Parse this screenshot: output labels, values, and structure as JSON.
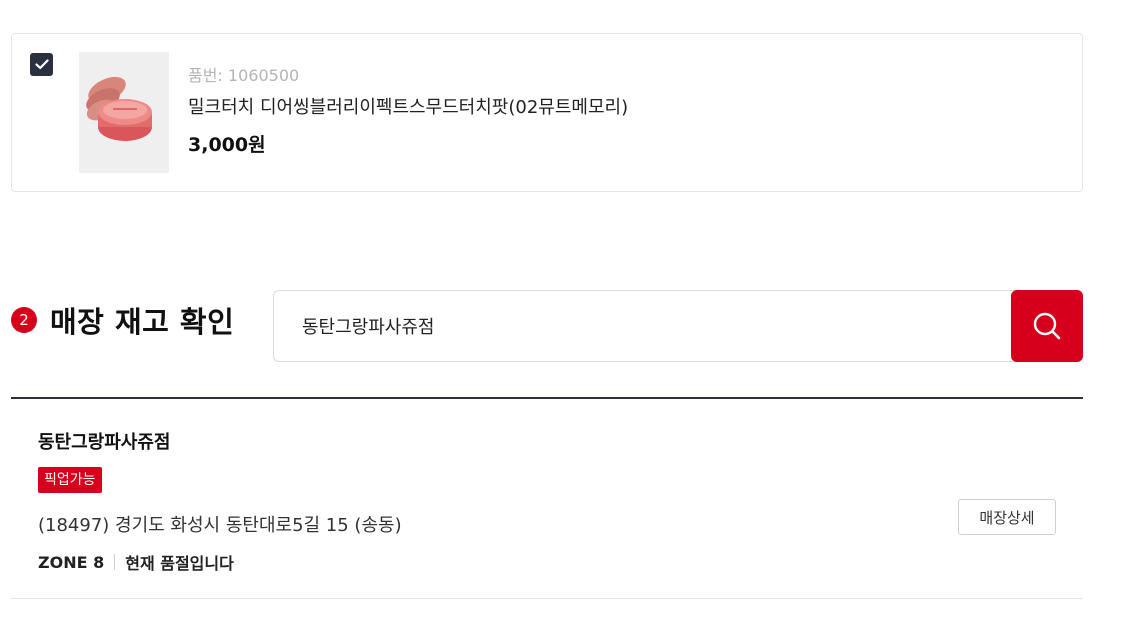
{
  "product": {
    "code": "품번: 1060500",
    "name": "밀크터치 디어씽블러리이펙트스무드터치팟(02뮤트메모리)",
    "price": "3,000원",
    "checked": true,
    "image_icon": "lip-pot-product-image"
  },
  "stock_section": {
    "step_number": "2",
    "heading": "매장 재고 확인",
    "search": {
      "value": "동탄그랑파사쥬점",
      "button_icon": "search-icon"
    }
  },
  "store_result": {
    "name": "동탄그랑파사쥬점",
    "badge": "픽업가능",
    "address": "(18497) 경기도 화성시 동탄대로5길 15 (송동)",
    "zone": "ZONE 8",
    "stock_status": "현재 품절입니다",
    "detail_button_label": "매장상세"
  },
  "colors": {
    "accent_red": "#d6001c",
    "checkbox_dark": "#2b3040"
  }
}
